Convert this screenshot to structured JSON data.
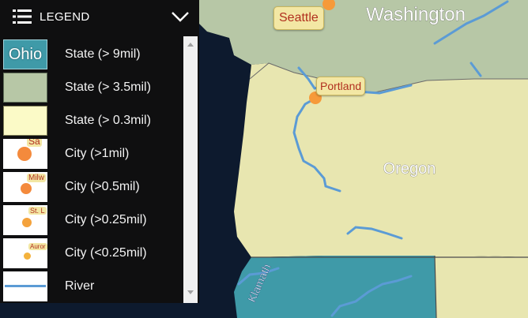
{
  "legend": {
    "title": "LEGEND",
    "items": [
      {
        "label": "State (> 9mil)",
        "swatch_text": "Ohio",
        "swatch": "state-large",
        "color": "#3f9aa8"
      },
      {
        "label": "State (> 3.5mil)",
        "swatch": "state-medium",
        "color": "#b7c7a6"
      },
      {
        "label": "State (> 0.3mil)",
        "swatch": "state-small",
        "color": "#fbfac7"
      },
      {
        "label": "City (>1mil)",
        "swatch_text": "Sa",
        "swatch": "city-1mil",
        "color": "#f48a3c"
      },
      {
        "label": "City (>0.5mil)",
        "swatch_text": "Milw",
        "swatch": "city-05mil",
        "color": "#f48a3c"
      },
      {
        "label": "City (>0.25mil)",
        "swatch_text": "St. L",
        "swatch": "city-025mil",
        "color": "#f4a23c"
      },
      {
        "label": "City (<0.25mil)",
        "swatch_text": "Auror",
        "swatch": "city-small",
        "color": "#f4b23c"
      },
      {
        "label": "River",
        "swatch": "river",
        "color": "#5b9bd5"
      }
    ]
  },
  "map": {
    "states": [
      {
        "name": "Washington"
      },
      {
        "name": "Oregon"
      }
    ],
    "cities": [
      {
        "name": "Seattle"
      },
      {
        "name": "Portland"
      }
    ],
    "rivers": [
      {
        "name": "Klamath"
      }
    ],
    "colors": {
      "ocean": "#0d1a2e",
      "washington": "#b7c7a6",
      "oregon": "#e8e6b0",
      "california": "#3f9aa8",
      "river": "#5b9bd5",
      "city_dot": "#f69a3a",
      "city_badge": "#f3e7a4",
      "city_text": "#b1301f"
    }
  }
}
